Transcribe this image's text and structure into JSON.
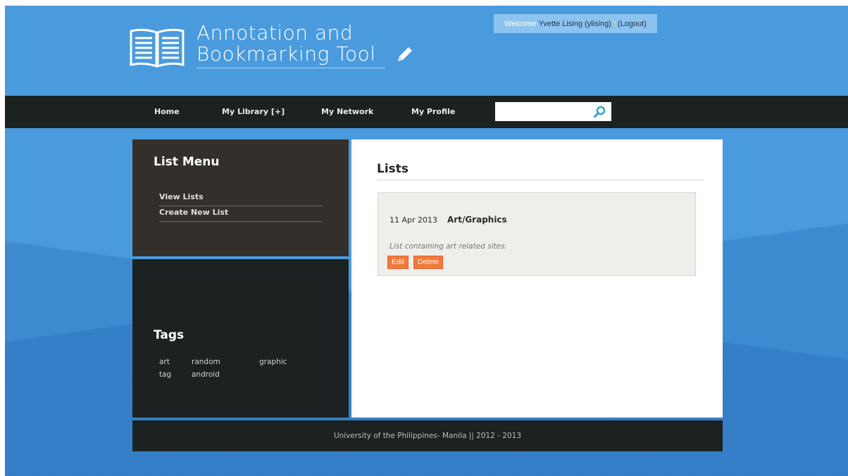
{
  "header": {
    "title_line1": "Annotation and",
    "title_line2": "Bookmarking Tool",
    "welcome_label": "Welcome",
    "user_name": "Yvette Lising (ylising)",
    "bang": "!",
    "logout": "(Logout)"
  },
  "nav": {
    "items": [
      {
        "label": "Home"
      },
      {
        "label": "My Library [+]"
      },
      {
        "label": "My Network"
      },
      {
        "label": "My Profile"
      }
    ],
    "search": {
      "value": "",
      "placeholder": ""
    }
  },
  "sidebar": {
    "list_menu_title": "List Menu",
    "links": [
      {
        "label": "View Lists"
      },
      {
        "label": "Create New List"
      }
    ],
    "tags_title": "Tags",
    "tags": [
      "art",
      "random",
      "graphic",
      "tag",
      "android"
    ]
  },
  "main": {
    "title": "Lists",
    "list": {
      "date": "11 Apr 2013",
      "name": "Art/Graphics",
      "description": "List containing art related sites.",
      "edit_label": "Edit",
      "delete_label": "Delete"
    }
  },
  "footer": {
    "text": "University of the Philippines- Manila || 2012 - 2013"
  },
  "colors": {
    "background": "#4a9bde",
    "nav": "#1b2221",
    "list_menu_panel": "#352f2c",
    "button": "#f07a3c",
    "search_icon": "#2aa0d8"
  },
  "icons": [
    "book-logo-icon",
    "pencil-icon",
    "search-icon"
  ]
}
